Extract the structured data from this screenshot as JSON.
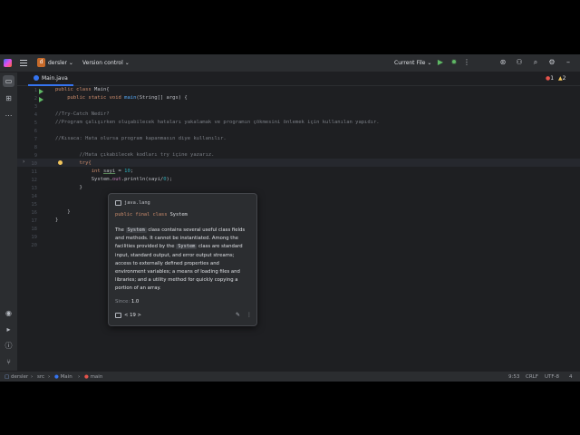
{
  "title_bar": {
    "project_badge": "d",
    "project_name": "dersler",
    "version_control": "Version control",
    "run_config": "Current File"
  },
  "tabs": [
    {
      "label": "Main.java"
    }
  ],
  "inspections": {
    "errors": "1",
    "warnings": "2"
  },
  "editor": {
    "line_numbers": [
      "1",
      "2",
      "3",
      "4",
      "5",
      "6",
      "7",
      "8",
      "9",
      "10",
      "11",
      "12",
      "13",
      "14",
      "15",
      "16",
      "17",
      "18",
      "19",
      "20"
    ],
    "lines": {
      "l1a": "public class ",
      "l1b": "Main{",
      "l2a": "    public static void ",
      "l2b": "main",
      "l2c": "(String[] args) {",
      "l4": "//Try-Catch Nedir?",
      "l5": "//Program çalışırken oluşabilecek hataları yakalamak ve programın çökmesini önlemek için kullanılan yapıdır.",
      "l7": "//Kısaca: Hata olursa program kapanmasın diye kullanılır.",
      "l9": "        //Hata çıkabilecek kodları try içine yazarız.",
      "l10": "        try{",
      "l11a": "            int ",
      "l11b": "sayi",
      "l11c": " = ",
      "l11d": "10",
      "l11e": ";",
      "l12a": "            System.",
      "l12b": "out",
      "l12c": ".println(sayi/",
      "l12d": "0",
      "l12e": ");",
      "l13": "        }",
      "l16": "    }",
      "l17": "}"
    }
  },
  "doc_popup": {
    "package": "java.lang",
    "signature_kw": "public final class ",
    "signature_name": "System",
    "desc_1": "The ",
    "desc_code1": "System",
    "desc_2": " class contains several useful class fields and methods. It cannot be instantiated. Among the facilities provided by the ",
    "desc_code2": "System",
    "desc_3": " class are standard input, standard output, and error output streams; access to externally defined properties and environment variables; a means of loading files and libraries; and a utility method for quickly copying a portion of an array.",
    "since_label": "Since: ",
    "since_value": "1.0",
    "module": "< 19 >"
  },
  "status_bar": {
    "crumbs": [
      "dersler",
      "src",
      "Main",
      "main"
    ],
    "position": "9:53",
    "line_ending": "CRLF",
    "encoding": "UTF-8",
    "indent": "4"
  },
  "colors": {
    "background": "#1e1f22",
    "panel": "#2b2d30",
    "accent": "#3574f0",
    "run_green": "#5fb865",
    "error_red": "#e5534b",
    "warning_yellow": "#f2c55c"
  }
}
